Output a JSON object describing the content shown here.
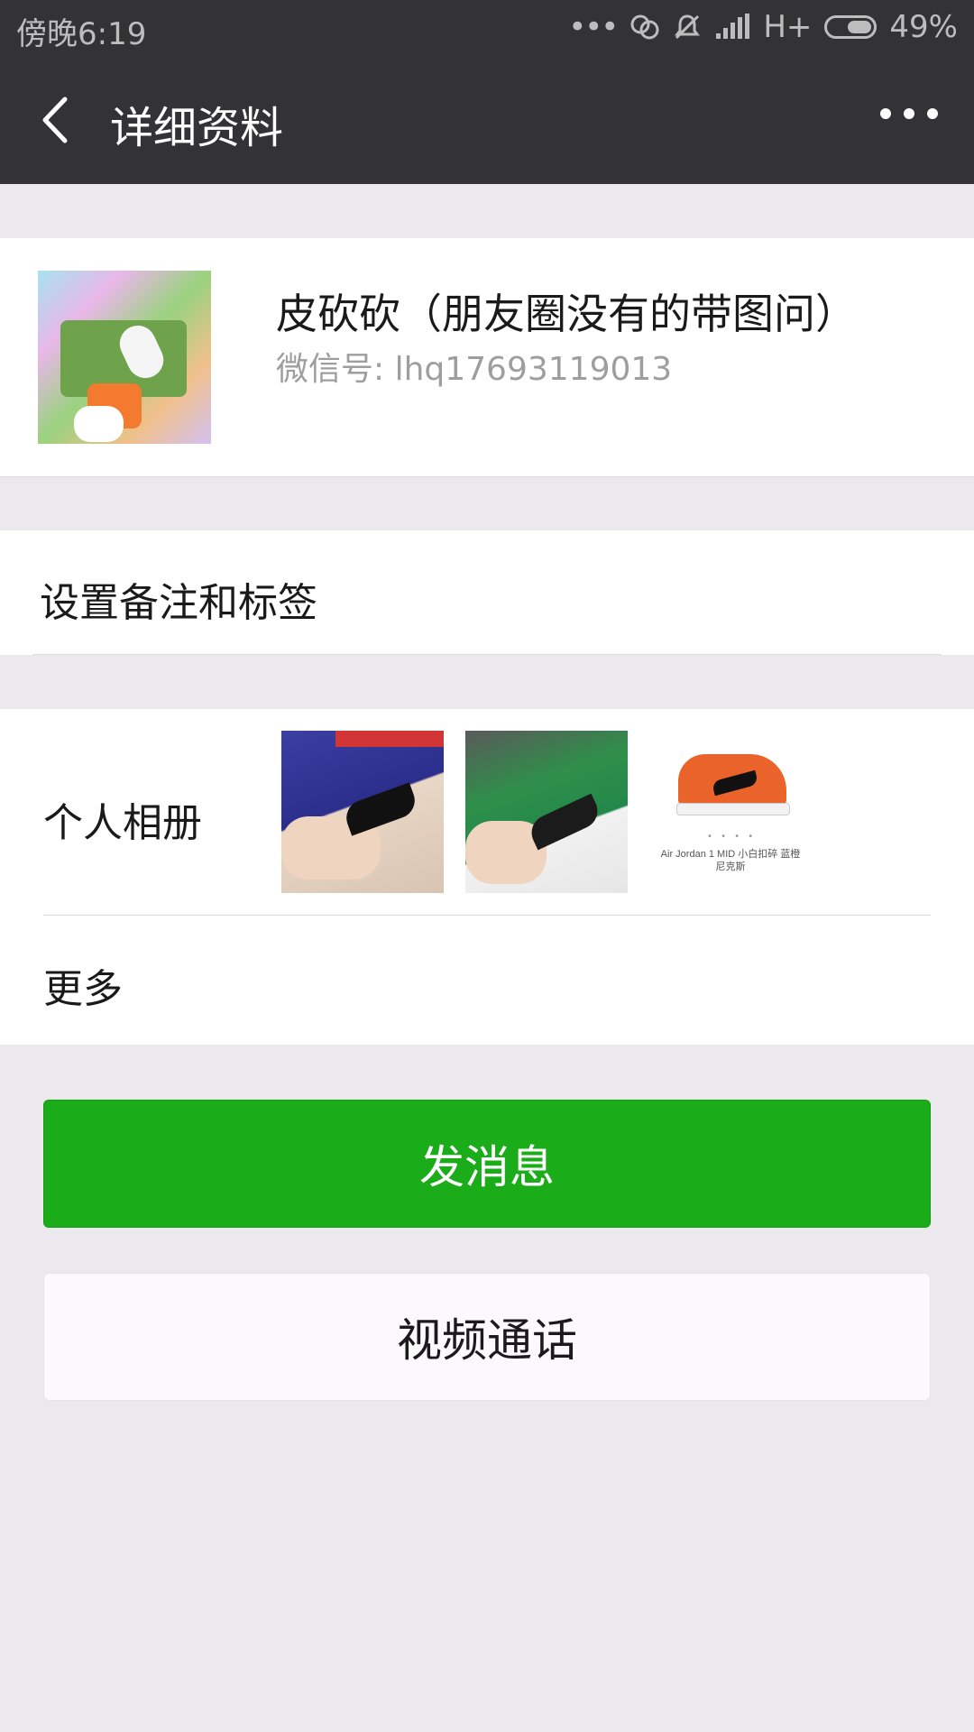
{
  "status_bar": {
    "time": "傍晚6:19",
    "network": "H+",
    "battery": "49%"
  },
  "header": {
    "title": "详细资料"
  },
  "profile": {
    "name": "皮砍砍（朋友圈没有的带图问）",
    "wechat_id": "微信号: lhq17693119013"
  },
  "remark": {
    "label": "设置备注和标签"
  },
  "album": {
    "label": "个人相册",
    "thumb3_caption": "Air Jordan 1 MID 小白扣碎 蓝橙尼克斯",
    "more_label": "更多"
  },
  "actions": {
    "send_message": "发消息",
    "video_call": "视频通话"
  },
  "colors": {
    "header_bg": "#333335",
    "page_bg": "#ECE9EE",
    "primary_button": "#1AAD19"
  },
  "icons": {
    "back": "chevron-left-icon",
    "menu": "more-dots-icon"
  }
}
